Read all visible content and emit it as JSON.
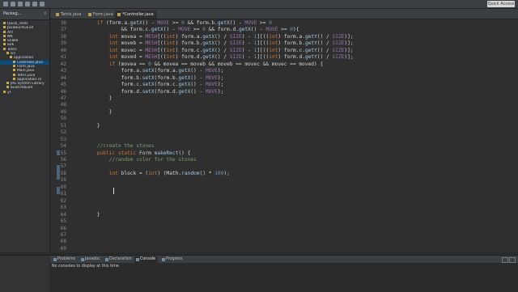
{
  "toolbar": {
    "quick_access": "Quick Access"
  },
  "package_explorer": {
    "title": "Packag...",
    "items": [
      {
        "label": "Quick_Tests",
        "indent": 1
      },
      {
        "label": "JavaBuchGE18",
        "indent": 1
      },
      {
        "label": "Ah!",
        "indent": 1
      },
      {
        "label": "NN",
        "indent": 1
      },
      {
        "label": "Snake",
        "indent": 1
      },
      {
        "label": "Snk",
        "indent": 1
      },
      {
        "label": "Tetris",
        "indent": 1
      },
      {
        "label": "src",
        "indent": 2
      },
      {
        "label": "application",
        "indent": 3
      },
      {
        "label": "Controller.java",
        "indent": 4,
        "selected": true
      },
      {
        "label": "Form.java",
        "indent": 4
      },
      {
        "label": "Main.java",
        "indent": 4
      },
      {
        "label": "Tetris.java",
        "indent": 4
      },
      {
        "label": "application.cs",
        "indent": 4
      },
      {
        "label": "JRE System Library",
        "indent": 2
      },
      {
        "label": "build.fxbuild",
        "indent": 2
      },
      {
        "label": "yt",
        "indent": 1
      }
    ]
  },
  "editor": {
    "tabs": [
      {
        "label": "Tetris.java",
        "active": false
      },
      {
        "label": "Form.java",
        "active": false
      },
      {
        "label": "*Controller.java",
        "active": true
      }
    ],
    "lines": [
      {
        "n": "36",
        "text": "        if (form.a.getX() - MOVE >= 0 && form.b.getX() - MOVE >= 0"
      },
      {
        "n": "37",
        "text": "                && form.c.getX() - MOVE >= 0 && form.d.getX() - MOVE >= 0){"
      },
      {
        "n": "38",
        "text": "            int movea = MESH[((int) form.a.getX() / SIZE) - 1][((int) form.a.getY() / SIZE)];"
      },
      {
        "n": "39",
        "text": "            int moveb = MESH[((int) form.b.getX() / SIZE) - 1][((int) form.b.getY() / SIZE)];"
      },
      {
        "n": "40",
        "text": "            int movec = MESH[((int) form.c.getX() / SIZE) - 1][((int) form.c.getY() / SIZE)];"
      },
      {
        "n": "41",
        "text": "            int moved = MESH[((int) form.d.getX() / SIZE) - 1][((int) form.d.getY() / SIZE)];"
      },
      {
        "n": "42",
        "text": "            if (movea == 0 && movea == moveb && moveb == movec && movec == moved) {"
      },
      {
        "n": "43",
        "text": "                form.a.setX(form.a.getX() - MOVE);"
      },
      {
        "n": "44",
        "text": "                form.b.setX(form.b.getX() - MOVE);"
      },
      {
        "n": "45",
        "text": "                form.c.setX(form.c.getX() - MOVE);"
      },
      {
        "n": "46",
        "text": "                form.d.setX(form.d.getX() - MOVE);"
      },
      {
        "n": "47",
        "text": "            }"
      },
      {
        "n": "48",
        "text": ""
      },
      {
        "n": "49",
        "text": "            }"
      },
      {
        "n": "50",
        "text": ""
      },
      {
        "n": "51",
        "text": "        }"
      },
      {
        "n": "52",
        "text": ""
      },
      {
        "n": "53",
        "text": ""
      },
      {
        "n": "54",
        "text": "        //create the stones"
      },
      {
        "n": "55",
        "text": "        public static Form makeRect() {"
      },
      {
        "n": "56",
        "text": "            //random color for the stones"
      },
      {
        "n": "57",
        "text": ""
      },
      {
        "n": "58",
        "text": "            int block = (int) (Math.random() * 100);"
      },
      {
        "n": "59",
        "text": "            "
      },
      {
        "n": "60",
        "text": ""
      },
      {
        "n": "61",
        "text": ""
      },
      {
        "n": "62",
        "text": ""
      },
      {
        "n": "63",
        "text": ""
      },
      {
        "n": "64",
        "text": "        }"
      },
      {
        "n": "65",
        "text": ""
      },
      {
        "n": "66",
        "text": ""
      },
      {
        "n": "67",
        "text": ""
      },
      {
        "n": "68",
        "text": ""
      },
      {
        "n": "69",
        "text": ""
      }
    ]
  },
  "bottom_panel": {
    "tabs": [
      {
        "label": "Problems",
        "active": false
      },
      {
        "label": "Javadoc",
        "active": false
      },
      {
        "label": "Declaration",
        "active": false
      },
      {
        "label": "Console",
        "active": true
      },
      {
        "label": "Progress",
        "active": false
      }
    ],
    "message": "No consoles to display at this time."
  },
  "colors": {
    "background": "#2f2f2f",
    "keyword": "#cc7832",
    "field": "#9876aa",
    "comment": "#7a9b6c",
    "number": "#6897bb",
    "method": "#9ec9e6"
  }
}
